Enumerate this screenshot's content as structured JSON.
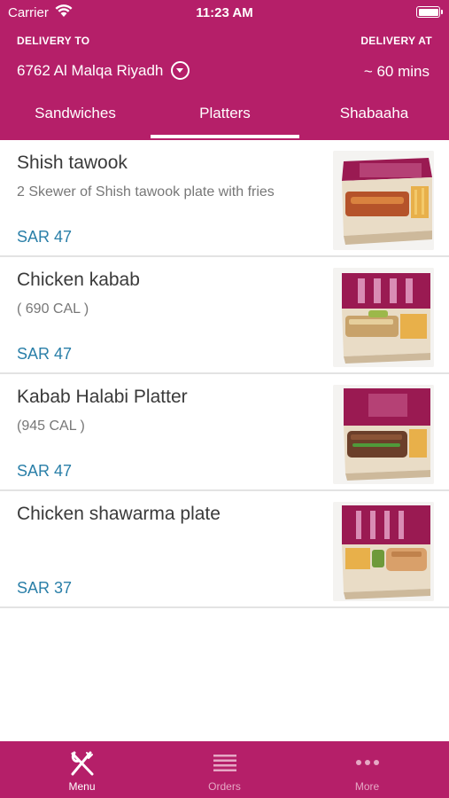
{
  "status_bar": {
    "carrier": "Carrier",
    "time": "11:23 AM"
  },
  "header": {
    "delivery_to_label": "DELIVERY TO",
    "delivery_at_label": "DELIVERY AT",
    "address": "6762 Al Malqa Riyadh",
    "eta": "~ 60 mins"
  },
  "tabs": [
    {
      "label": "Sandwiches",
      "selected": false
    },
    {
      "label": "Platters",
      "selected": true
    },
    {
      "label": "Shabaaha",
      "selected": false
    }
  ],
  "items": [
    {
      "title": "Shish tawook",
      "description": "2 Skewer of  Shish tawook plate with fries",
      "price": "SAR 47",
      "image": "shish-tawook-box"
    },
    {
      "title": "Chicken kabab",
      "description": "( 690 CAL )",
      "price": "SAR 47",
      "image": "chicken-kabab-box"
    },
    {
      "title": "Kabab Halabi Platter",
      "description": "(945 CAL )",
      "price": "SAR 47",
      "image": "kabab-halabi-box"
    },
    {
      "title": "Chicken shawarma plate",
      "description": "",
      "price": "SAR 37",
      "image": "chicken-shawarma-box"
    }
  ],
  "tabbar": [
    {
      "label": "Menu",
      "icon": "fork-knife-icon",
      "active": true
    },
    {
      "label": "Orders",
      "icon": "list-icon",
      "active": false
    },
    {
      "label": "More",
      "icon": "ellipsis-icon",
      "active": false
    }
  ],
  "colors": {
    "brand": "#b51f69",
    "price": "#2a7fa8",
    "title": "#3a3a3a",
    "description": "#777777",
    "divider": "#e3e3e3"
  }
}
